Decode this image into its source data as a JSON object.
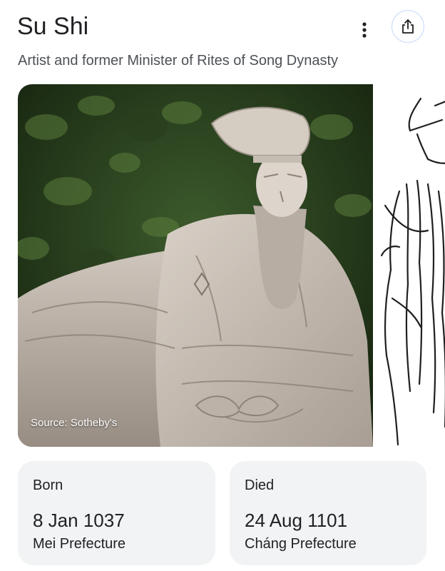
{
  "header": {
    "title": "Su Shi",
    "subtitle": "Artist and former Minister of Rites of Song Dynasty",
    "more_icon": "vertical-dots-icon",
    "share_icon": "share-icon"
  },
  "images": {
    "main": {
      "source_caption": "Source: Sotheby's"
    }
  },
  "facts": {
    "born": {
      "label": "Born",
      "date": "8 Jan 1037",
      "place": "Mei Prefecture"
    },
    "died": {
      "label": "Died",
      "date": "24 Aug 1101",
      "place": "Cháng Prefecture"
    }
  },
  "colors": {
    "accent": "#1a73e8",
    "card_bg": "#f1f3f4",
    "share_border": "#c6dafc"
  }
}
